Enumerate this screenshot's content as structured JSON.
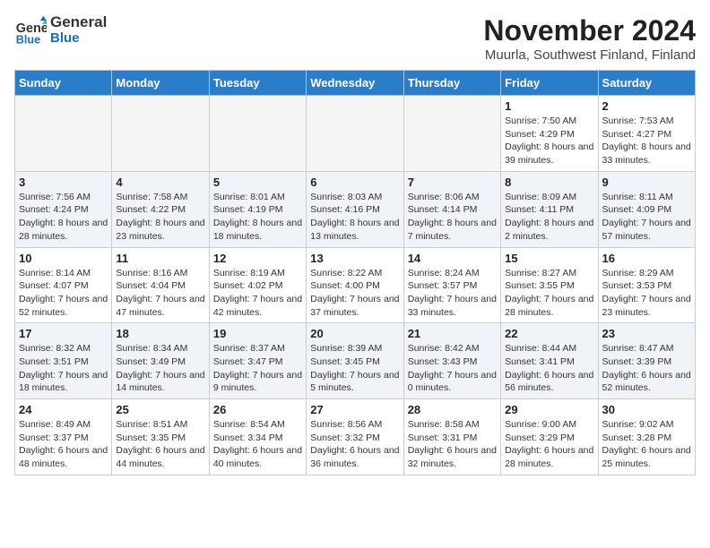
{
  "logo": {
    "line1": "General",
    "line2": "Blue"
  },
  "title": "November 2024",
  "location": "Muurla, Southwest Finland, Finland",
  "weekdays": [
    "Sunday",
    "Monday",
    "Tuesday",
    "Wednesday",
    "Thursday",
    "Friday",
    "Saturday"
  ],
  "weeks": [
    [
      {
        "day": "",
        "info": ""
      },
      {
        "day": "",
        "info": ""
      },
      {
        "day": "",
        "info": ""
      },
      {
        "day": "",
        "info": ""
      },
      {
        "day": "",
        "info": ""
      },
      {
        "day": "1",
        "info": "Sunrise: 7:50 AM\nSunset: 4:29 PM\nDaylight: 8 hours and 39 minutes."
      },
      {
        "day": "2",
        "info": "Sunrise: 7:53 AM\nSunset: 4:27 PM\nDaylight: 8 hours and 33 minutes."
      }
    ],
    [
      {
        "day": "3",
        "info": "Sunrise: 7:56 AM\nSunset: 4:24 PM\nDaylight: 8 hours and 28 minutes."
      },
      {
        "day": "4",
        "info": "Sunrise: 7:58 AM\nSunset: 4:22 PM\nDaylight: 8 hours and 23 minutes."
      },
      {
        "day": "5",
        "info": "Sunrise: 8:01 AM\nSunset: 4:19 PM\nDaylight: 8 hours and 18 minutes."
      },
      {
        "day": "6",
        "info": "Sunrise: 8:03 AM\nSunset: 4:16 PM\nDaylight: 8 hours and 13 minutes."
      },
      {
        "day": "7",
        "info": "Sunrise: 8:06 AM\nSunset: 4:14 PM\nDaylight: 8 hours and 7 minutes."
      },
      {
        "day": "8",
        "info": "Sunrise: 8:09 AM\nSunset: 4:11 PM\nDaylight: 8 hours and 2 minutes."
      },
      {
        "day": "9",
        "info": "Sunrise: 8:11 AM\nSunset: 4:09 PM\nDaylight: 7 hours and 57 minutes."
      }
    ],
    [
      {
        "day": "10",
        "info": "Sunrise: 8:14 AM\nSunset: 4:07 PM\nDaylight: 7 hours and 52 minutes."
      },
      {
        "day": "11",
        "info": "Sunrise: 8:16 AM\nSunset: 4:04 PM\nDaylight: 7 hours and 47 minutes."
      },
      {
        "day": "12",
        "info": "Sunrise: 8:19 AM\nSunset: 4:02 PM\nDaylight: 7 hours and 42 minutes."
      },
      {
        "day": "13",
        "info": "Sunrise: 8:22 AM\nSunset: 4:00 PM\nDaylight: 7 hours and 37 minutes."
      },
      {
        "day": "14",
        "info": "Sunrise: 8:24 AM\nSunset: 3:57 PM\nDaylight: 7 hours and 33 minutes."
      },
      {
        "day": "15",
        "info": "Sunrise: 8:27 AM\nSunset: 3:55 PM\nDaylight: 7 hours and 28 minutes."
      },
      {
        "day": "16",
        "info": "Sunrise: 8:29 AM\nSunset: 3:53 PM\nDaylight: 7 hours and 23 minutes."
      }
    ],
    [
      {
        "day": "17",
        "info": "Sunrise: 8:32 AM\nSunset: 3:51 PM\nDaylight: 7 hours and 18 minutes."
      },
      {
        "day": "18",
        "info": "Sunrise: 8:34 AM\nSunset: 3:49 PM\nDaylight: 7 hours and 14 minutes."
      },
      {
        "day": "19",
        "info": "Sunrise: 8:37 AM\nSunset: 3:47 PM\nDaylight: 7 hours and 9 minutes."
      },
      {
        "day": "20",
        "info": "Sunrise: 8:39 AM\nSunset: 3:45 PM\nDaylight: 7 hours and 5 minutes."
      },
      {
        "day": "21",
        "info": "Sunrise: 8:42 AM\nSunset: 3:43 PM\nDaylight: 7 hours and 0 minutes."
      },
      {
        "day": "22",
        "info": "Sunrise: 8:44 AM\nSunset: 3:41 PM\nDaylight: 6 hours and 56 minutes."
      },
      {
        "day": "23",
        "info": "Sunrise: 8:47 AM\nSunset: 3:39 PM\nDaylight: 6 hours and 52 minutes."
      }
    ],
    [
      {
        "day": "24",
        "info": "Sunrise: 8:49 AM\nSunset: 3:37 PM\nDaylight: 6 hours and 48 minutes."
      },
      {
        "day": "25",
        "info": "Sunrise: 8:51 AM\nSunset: 3:35 PM\nDaylight: 6 hours and 44 minutes."
      },
      {
        "day": "26",
        "info": "Sunrise: 8:54 AM\nSunset: 3:34 PM\nDaylight: 6 hours and 40 minutes."
      },
      {
        "day": "27",
        "info": "Sunrise: 8:56 AM\nSunset: 3:32 PM\nDaylight: 6 hours and 36 minutes."
      },
      {
        "day": "28",
        "info": "Sunrise: 8:58 AM\nSunset: 3:31 PM\nDaylight: 6 hours and 32 minutes."
      },
      {
        "day": "29",
        "info": "Sunrise: 9:00 AM\nSunset: 3:29 PM\nDaylight: 6 hours and 28 minutes."
      },
      {
        "day": "30",
        "info": "Sunrise: 9:02 AM\nSunset: 3:28 PM\nDaylight: 6 hours and 25 minutes."
      }
    ]
  ]
}
